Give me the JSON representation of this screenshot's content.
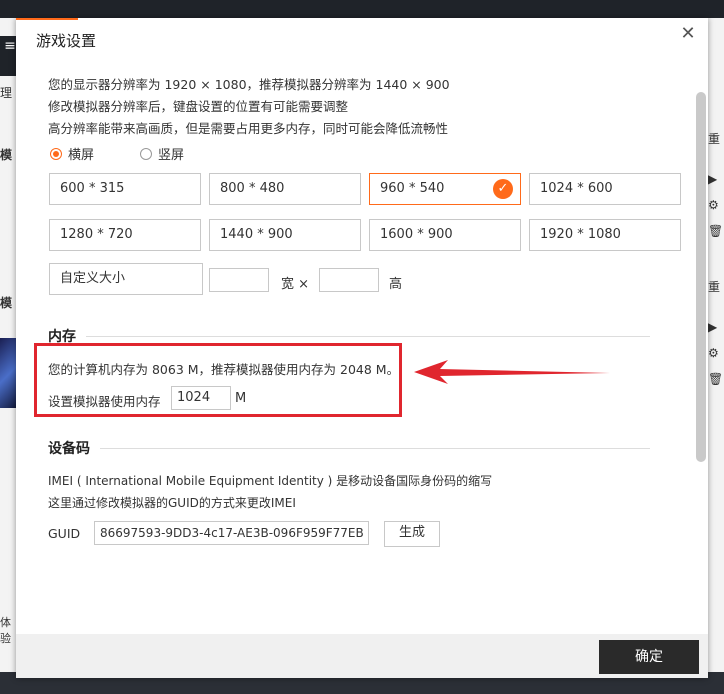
{
  "background": {
    "left_texts": [
      "理",
      "模",
      "模",
      "体验"
    ],
    "right_texts": [
      "重",
      "▶",
      "⚙",
      "🗑",
      "重",
      "▶",
      "⚙",
      "🗑"
    ]
  },
  "dialog": {
    "title": "游戏设置",
    "close_icon": "close-icon",
    "display": {
      "line1": "您的显示器分辨率为 1920 × 1080，推荐模拟器分辨率为 1440 × 900",
      "line2": "修改模拟器分辨率后，键盘设置的位置有可能需要调整",
      "line3": "高分辨率能带来高画质，但是需要占用更多内存，同时可能会降低流畅性",
      "orientation": {
        "landscape": "横屏",
        "portrait": "竖屏",
        "selected": "landscape"
      },
      "resolutions": [
        "600 * 315",
        "800 * 480",
        "960 * 540",
        "1024 * 600",
        "1280 * 720",
        "1440 * 900",
        "1600 * 900",
        "1920 * 1080"
      ],
      "selected_resolution": "960 * 540",
      "custom_label": "自定义大小",
      "width_label": "宽 ×",
      "height_label": "高",
      "width_value": "",
      "height_value": ""
    },
    "memory": {
      "title": "内存",
      "info": "您的计算机内存为 8063 M，推荐模拟器使用内存为 2048 M。",
      "set_label": "设置模拟器使用内存",
      "value": "1024",
      "unit": "M"
    },
    "device": {
      "title": "设备码",
      "line1": "IMEI ( International Mobile Equipment Identity ) 是移动设备国际身份码的缩写",
      "line2": "这里通过修改模拟器的GUID的方式来更改IMEI",
      "guid_label": "GUID",
      "guid_value": "86697593-9DD3-4c17-AE3B-096F959F77EB",
      "generate_button": "生成"
    },
    "ok_button": "确定"
  },
  "colors": {
    "accent": "#ff6a1a",
    "highlight_box": "#e0262e",
    "ok_button_bg": "#2a2a2a"
  }
}
